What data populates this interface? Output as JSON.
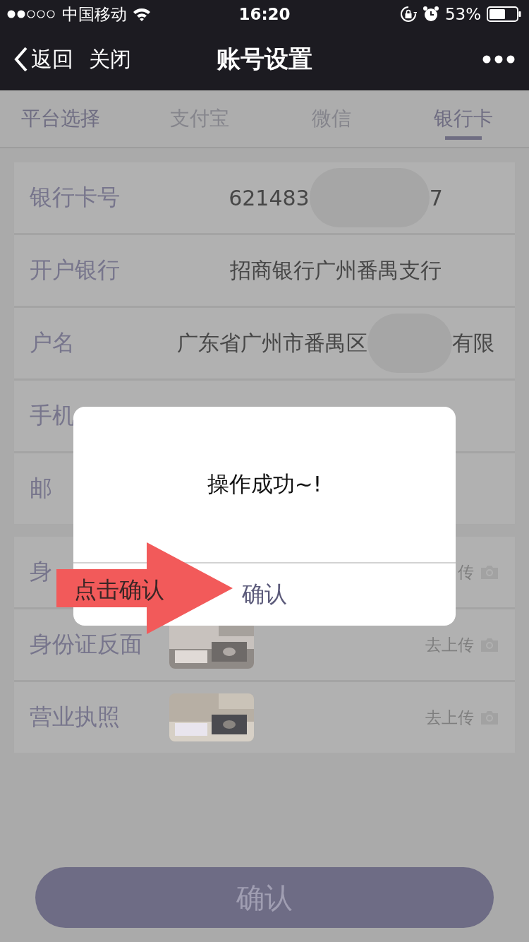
{
  "status_bar": {
    "carrier": "中国移动",
    "time": "16:20",
    "battery": "53%"
  },
  "nav": {
    "back": "返回",
    "close": "关闭",
    "title": "账号设置"
  },
  "platform_label": "平台选择",
  "tabs": [
    {
      "label": "支付宝",
      "selected": false,
      "disabled": true
    },
    {
      "label": "微信",
      "selected": false,
      "disabled": true
    },
    {
      "label": "银行卡",
      "selected": true,
      "disabled": false
    }
  ],
  "info_rows": [
    {
      "label": "银行卡号",
      "value": "621483",
      "value_tail": "7",
      "redacted": true
    },
    {
      "label": "开户银行",
      "value": "招商银行广州番禺支行",
      "redacted": false
    },
    {
      "label": "户名",
      "value": "广东省广州市番禺区",
      "value_tail": "有限",
      "redacted": true
    },
    {
      "label": "手机",
      "redacted": false
    },
    {
      "label": "邮",
      "redacted": false
    }
  ],
  "photo_rows": [
    {
      "label": "身",
      "action": "传",
      "photo": false
    },
    {
      "label": "身份证反面",
      "action": "去上传",
      "photo": true
    },
    {
      "label": "营业执照",
      "action": "去上传",
      "photo": true
    }
  ],
  "submit_button": "确认",
  "dialog": {
    "message": "操作成功~!",
    "button": "确认"
  },
  "annotation": {
    "text": "点击确认"
  }
}
